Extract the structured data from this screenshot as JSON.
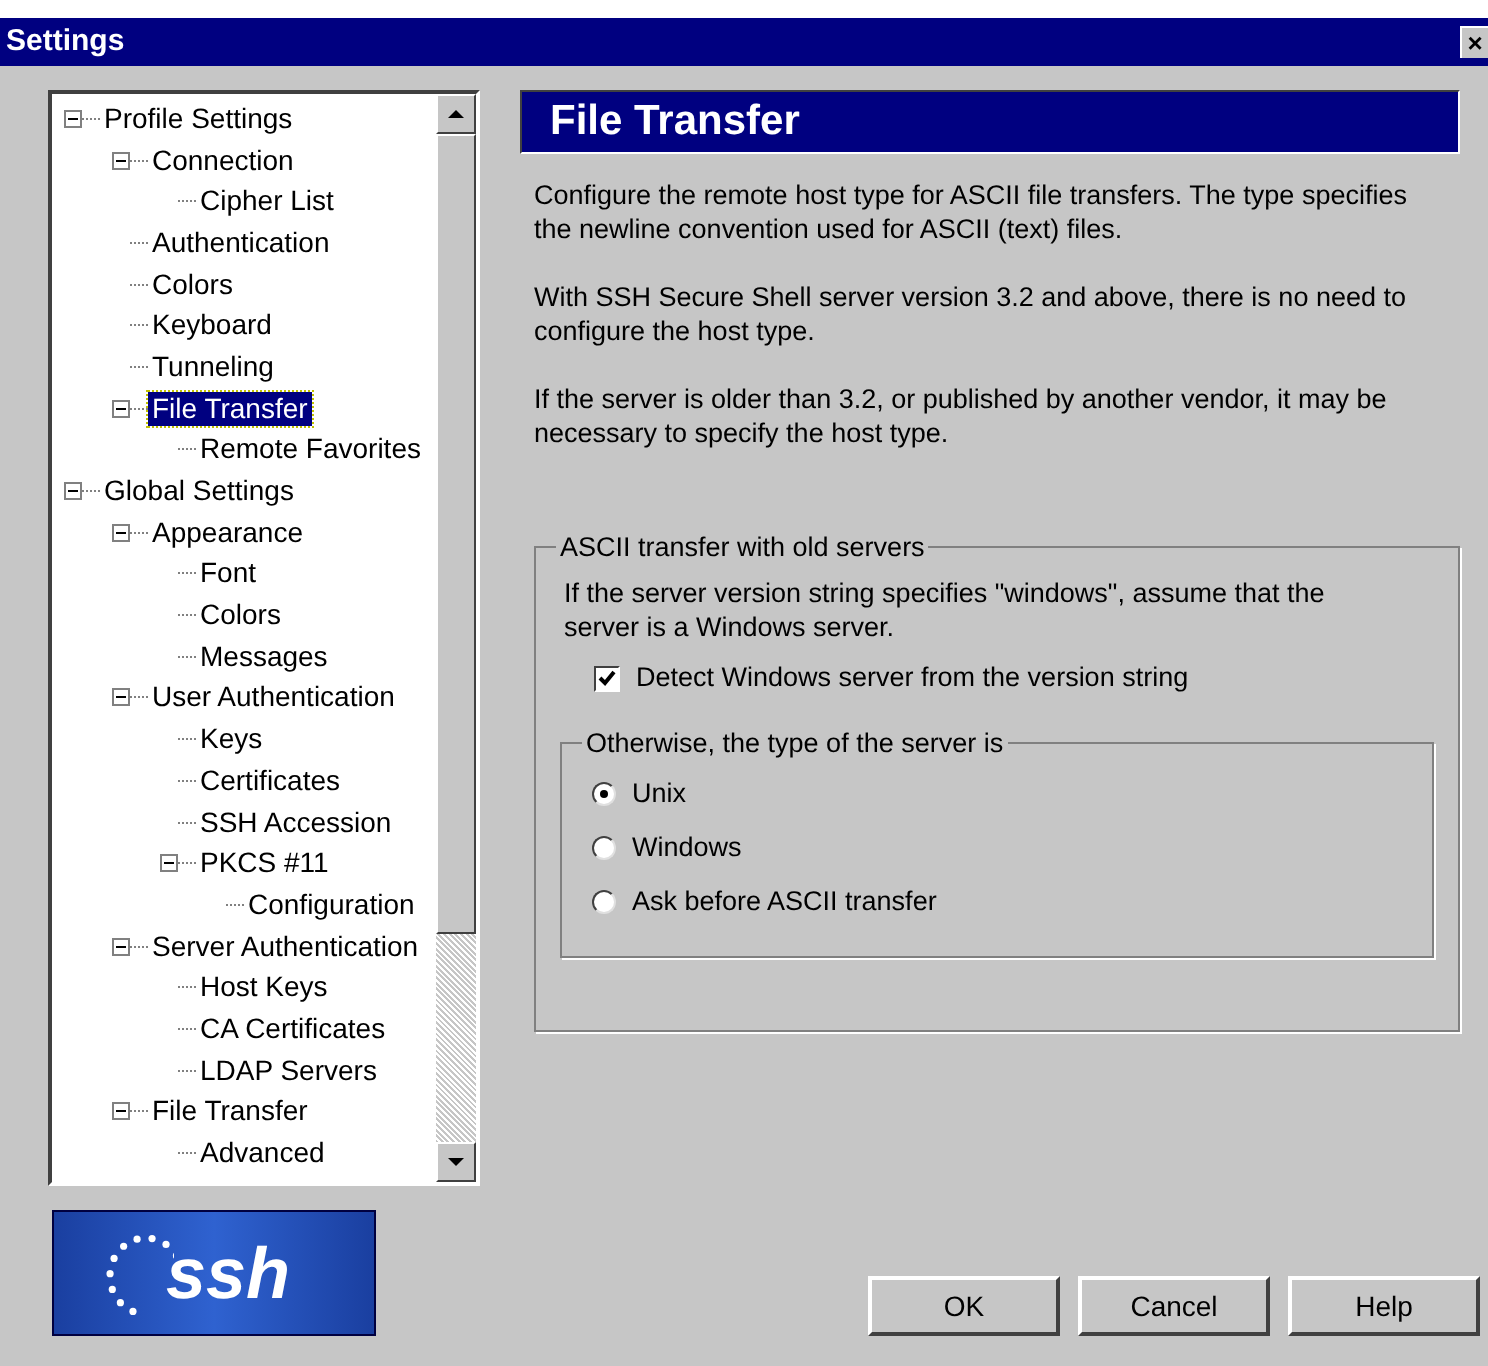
{
  "window": {
    "title": "Settings",
    "close": "×"
  },
  "tree": [
    {
      "label": "Profile Settings",
      "selected": false,
      "expanded": true,
      "children": [
        {
          "label": "Connection",
          "selected": false,
          "expanded": true,
          "children": [
            {
              "label": "Cipher List",
              "selected": false
            }
          ]
        },
        {
          "label": "Authentication",
          "selected": false
        },
        {
          "label": "Colors",
          "selected": false
        },
        {
          "label": "Keyboard",
          "selected": false
        },
        {
          "label": "Tunneling",
          "selected": false
        },
        {
          "label": "File Transfer",
          "selected": true,
          "expanded": true,
          "children": [
            {
              "label": "Remote Favorites",
              "selected": false
            }
          ]
        }
      ]
    },
    {
      "label": "Global Settings",
      "selected": false,
      "expanded": true,
      "children": [
        {
          "label": "Appearance",
          "selected": false,
          "expanded": true,
          "children": [
            {
              "label": "Font",
              "selected": false
            },
            {
              "label": "Colors",
              "selected": false
            },
            {
              "label": "Messages",
              "selected": false
            }
          ]
        },
        {
          "label": "User Authentication",
          "selected": false,
          "expanded": true,
          "children": [
            {
              "label": "Keys",
              "selected": false
            },
            {
              "label": "Certificates",
              "selected": false
            },
            {
              "label": "SSH Accession",
              "selected": false
            },
            {
              "label": "PKCS #11",
              "selected": false,
              "expanded": true,
              "children": [
                {
                  "label": "Configuration",
                  "selected": false
                }
              ]
            }
          ]
        },
        {
          "label": "Server Authentication",
          "selected": false,
          "expanded": true,
          "children": [
            {
              "label": "Host Keys",
              "selected": false
            },
            {
              "label": "CA Certificates",
              "selected": false
            },
            {
              "label": "LDAP Servers",
              "selected": false
            }
          ]
        },
        {
          "label": "File Transfer",
          "selected": false,
          "expanded": true,
          "children": [
            {
              "label": "Advanced",
              "selected": false
            }
          ]
        }
      ]
    }
  ],
  "logo": "ssh",
  "page": {
    "title": "File Transfer",
    "paragraphs": [
      "Configure the remote host type for ASCII file transfers. The type specifies the newline convention used for ASCII (text) files.",
      "With SSH Secure Shell server version 3.2 and above, there is no need to configure the host type.",
      "If the server is older than 3.2, or published by another vendor, it may be necessary to specify the host type."
    ]
  },
  "group": {
    "title": "ASCII transfer with old servers",
    "text": "If the server version string specifies \"windows\", assume that the server is a Windows server.",
    "checkbox": {
      "label": "Detect Windows server from the version string",
      "checked": true
    },
    "server_type": {
      "title": "Otherwise, the type of the server is",
      "options": [
        {
          "label": "Unix",
          "selected": true
        },
        {
          "label": "Windows",
          "selected": false
        },
        {
          "label": "Ask before ASCII transfer",
          "selected": false
        }
      ]
    }
  },
  "buttons": [
    "OK",
    "Cancel",
    "Help"
  ]
}
